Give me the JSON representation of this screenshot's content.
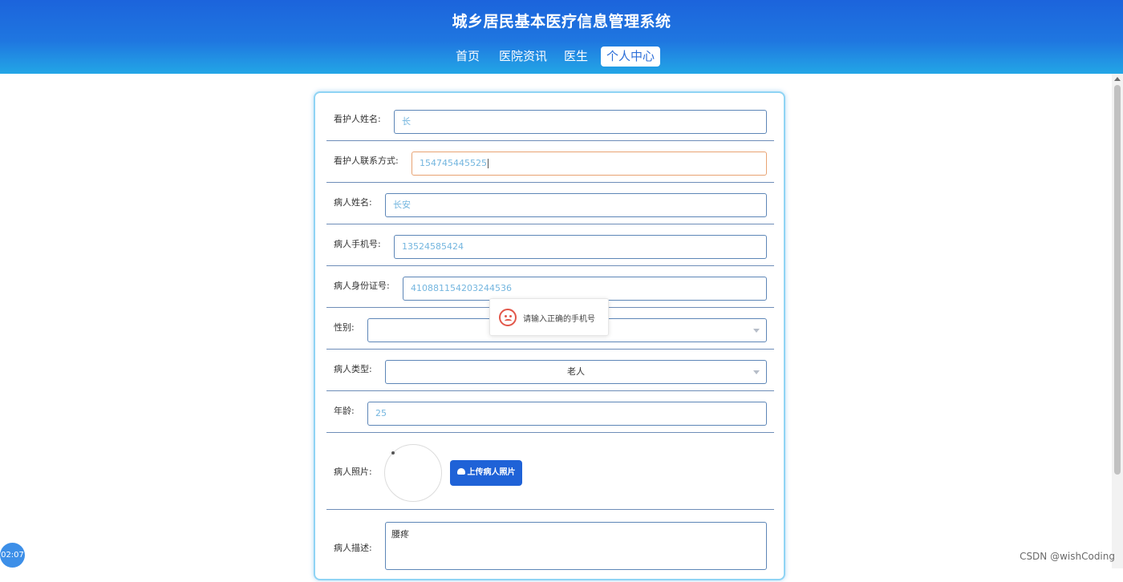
{
  "header": {
    "title": "城乡居民基本医疗信息管理系统",
    "nav": [
      {
        "label": "首页"
      },
      {
        "label": "医院资讯"
      },
      {
        "label": "医生"
      },
      {
        "label": "个人中心",
        "active": true
      }
    ]
  },
  "form": {
    "caregiver_name": {
      "label": "看护人姓名:",
      "value": "长"
    },
    "caregiver_contact": {
      "label": "看护人联系方式:",
      "value": "154745445525"
    },
    "patient_name": {
      "label": "病人姓名:",
      "value": "长安"
    },
    "patient_phone": {
      "label": "病人手机号:",
      "value": "13524585424"
    },
    "patient_id_number": {
      "label": "病人身份证号:",
      "value": "410881154203244536"
    },
    "gender": {
      "label": "性别:",
      "value": ""
    },
    "patient_type": {
      "label": "病人类型:",
      "value": "老人"
    },
    "age": {
      "label": "年龄:",
      "value": "25"
    },
    "patient_photo": {
      "label": "病人照片:",
      "upload_label": "上传病人照片"
    },
    "patient_description": {
      "label": "病人描述:",
      "value": "腰疼"
    }
  },
  "toast": {
    "message": "请输入正确的手机号",
    "icon": "sad-face-icon",
    "color": "#e2574a"
  },
  "overlay": {
    "timer": "02:07",
    "watermark": "CSDN @wishCoding"
  },
  "colors": {
    "header_top": "#1c64dc",
    "header_bottom": "#23a6e6",
    "primary_button": "#1f62d7",
    "input_text": "#74b6df",
    "focused_border": "#e8a373"
  }
}
